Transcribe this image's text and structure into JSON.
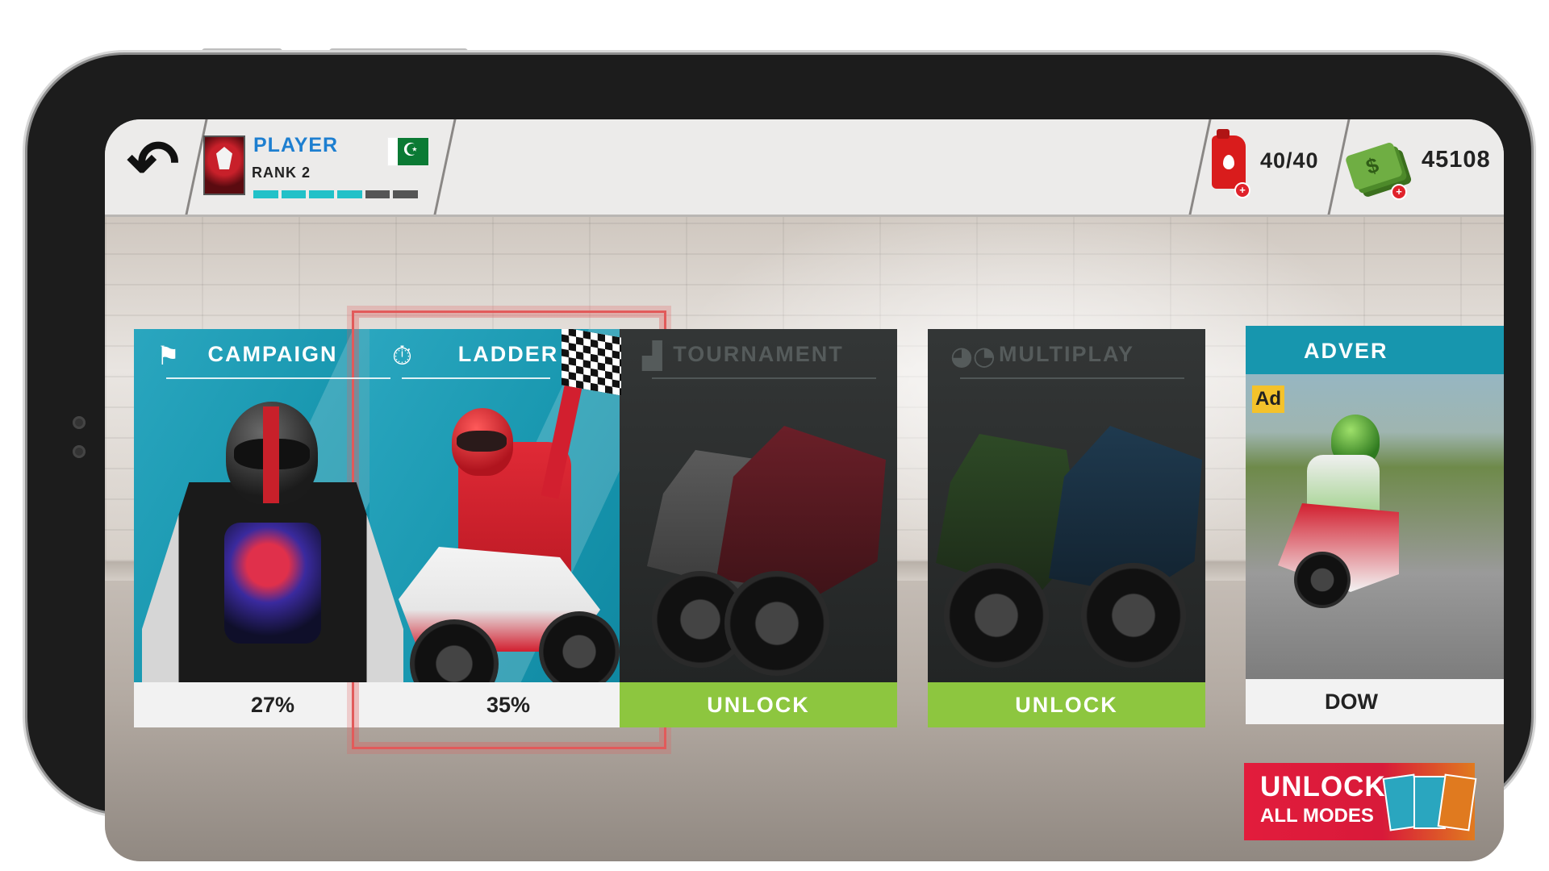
{
  "player": {
    "name": "PLAYER",
    "rank": "RANK 2",
    "xp_segments_filled": 4,
    "xp_segments_total": 6
  },
  "resources": {
    "fuel": "40/40",
    "cash": "45108"
  },
  "icons": {
    "back": "back-arrow-icon",
    "checkered": "checkered-flag-icon",
    "stopwatch": "stopwatch-icon",
    "podium": "podium-icon",
    "multiplayer": "multiplayer-icon",
    "fuel": "fuel-can-icon",
    "cash": "cash-stack-icon"
  },
  "modes": [
    {
      "title": "CAMPAIGN",
      "footer": "27%"
    },
    {
      "title": "LADDER",
      "footer": "35%"
    },
    {
      "title": "TOURNAMENT",
      "footer": "UNLOCK"
    },
    {
      "title": "MULTIPLAY",
      "footer": "UNLOCK"
    },
    {
      "title": "ADVER",
      "badge": "Ad",
      "footer": "DOW"
    }
  ],
  "unlock_all": {
    "line1": "UNLOCK",
    "line2": "ALL MODES"
  },
  "colors": {
    "teal": "#1796ae",
    "unlock_green": "#8dc63f",
    "selection_red": "#e25a5a",
    "banner_red": "#e21c3c"
  }
}
